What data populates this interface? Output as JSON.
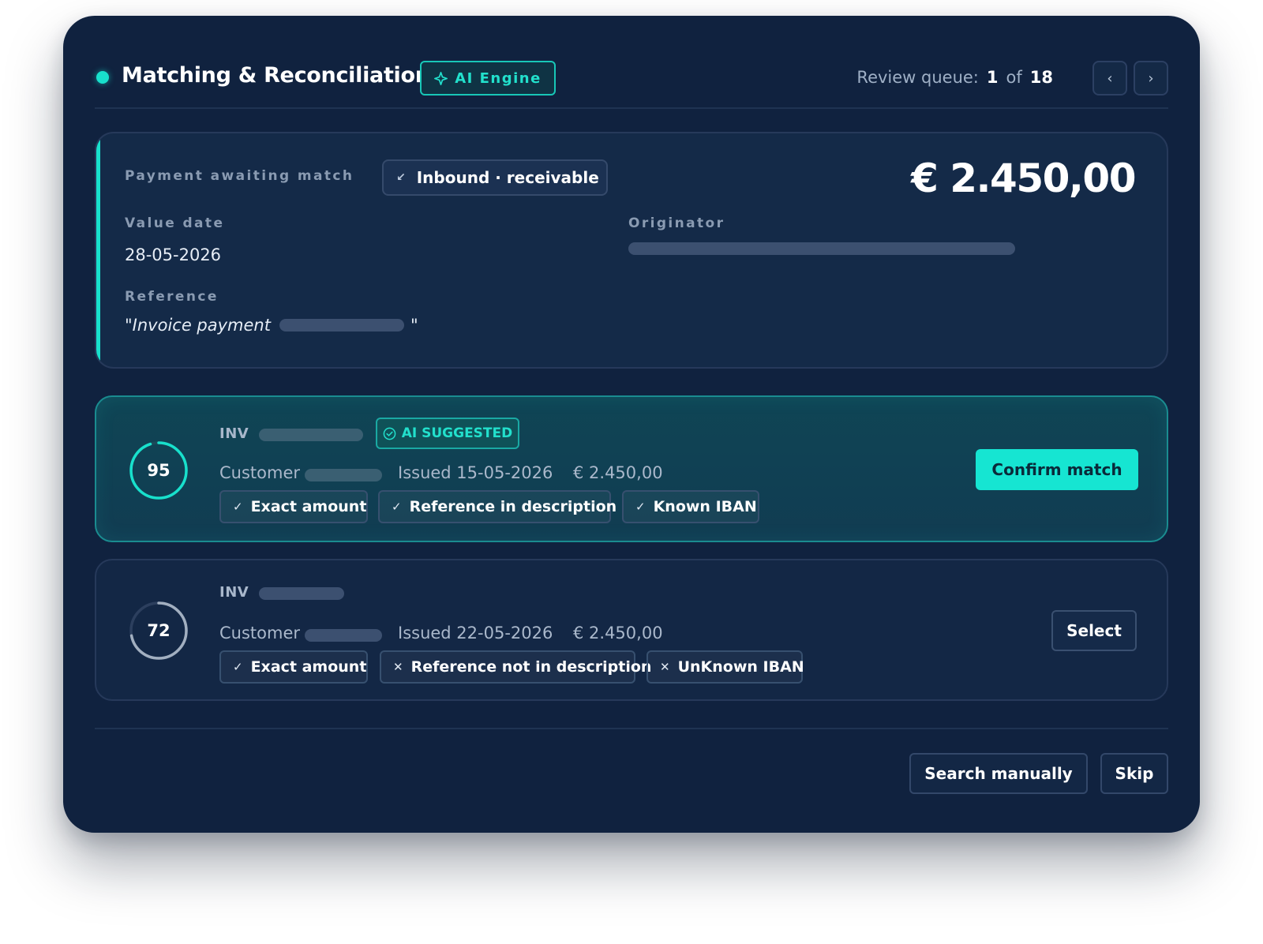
{
  "header": {
    "title": "Matching & Reconciliation",
    "engine_badge": "AI Engine",
    "queue_label": "Review queue:",
    "queue_current": "1",
    "queue_of": "of",
    "queue_total": "18",
    "prev_icon": "chevron-left-icon",
    "next_icon": "chevron-right-icon"
  },
  "payment": {
    "section_label": "Payment awaiting match",
    "direction": "Inbound · receivable",
    "amount": "€ 2.450,00",
    "value_date_label": "Value date",
    "value_date": "28-05-2026",
    "originator_label": "Originator",
    "reference_label": "Reference",
    "reference_prefix": "\"Invoice payment",
    "reference_suffix": "\""
  },
  "matches": [
    {
      "score": 95,
      "invoice_prefix": "INV",
      "badge": "AI SUGGESTED",
      "customer_label": "Customer",
      "issued": "Issued 15-05-2026",
      "amount": "€ 2.450,00",
      "chips": [
        {
          "mark": "✓",
          "label": "Exact amount"
        },
        {
          "mark": "✓",
          "label": "Reference in description"
        },
        {
          "mark": "✓",
          "label": "Known IBAN"
        }
      ],
      "action": "Confirm match"
    },
    {
      "score": 72,
      "invoice_prefix": "INV",
      "customer_label": "Customer",
      "issued": "Issued 22-05-2026",
      "amount": "€ 2.450,00",
      "chips": [
        {
          "mark": "✓",
          "label": "Exact amount"
        },
        {
          "mark": "✕",
          "label": "Reference not in description"
        },
        {
          "mark": "✕",
          "label": "UnKnown IBAN"
        }
      ],
      "action": "Select"
    }
  ],
  "footer": {
    "search_manually": "Search manually",
    "skip": "Skip"
  },
  "colors": {
    "accent": "#18e0cc",
    "background": "#10223f",
    "card": "#142a48"
  }
}
